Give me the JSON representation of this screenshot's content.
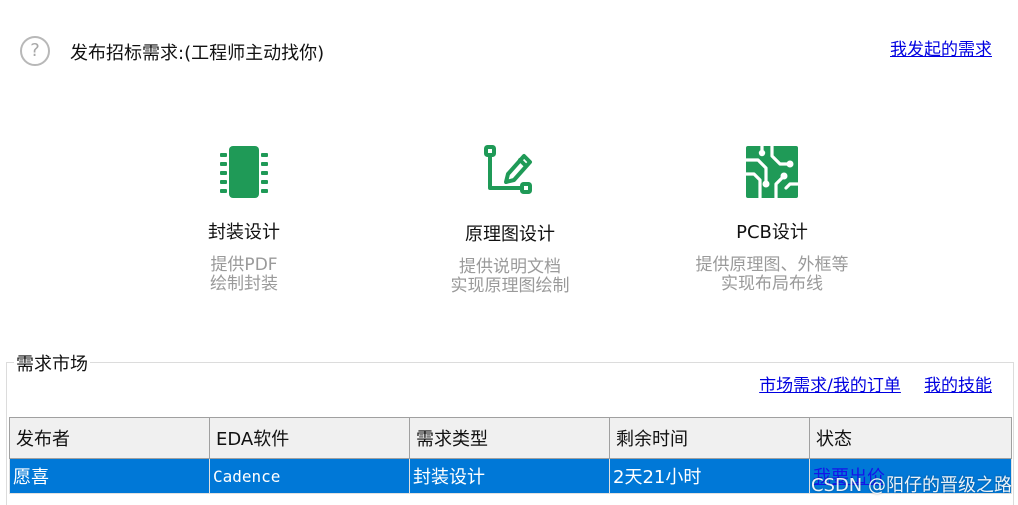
{
  "header": {
    "help_icon": "question-circle-icon",
    "title": "发布招标需求:(工程师主动找你)",
    "my_requests_link": "我发起的需求"
  },
  "services": [
    {
      "icon": "chip-icon",
      "name": "封装设计",
      "desc_line1": "提供PDF",
      "desc_line2": "绘制封装"
    },
    {
      "icon": "schematic-pen-icon",
      "name": "原理图设计",
      "desc_line1": "提供说明文档",
      "desc_line2": "实现原理图绘制"
    },
    {
      "icon": "pcb-circuit-icon",
      "name": "PCB设计",
      "desc_line1": "提供原理图、外框等",
      "desc_line2": "实现布局布线"
    }
  ],
  "market": {
    "title": "需求市场",
    "links": [
      "市场需求/我的订单",
      "我的技能"
    ],
    "columns": [
      "发布者",
      "EDA软件",
      "需求类型",
      "剩余时间",
      "状态"
    ],
    "rows": [
      {
        "publisher": "愿喜",
        "eda": "Cadence",
        "type": "封装设计",
        "remaining": "2天21小时",
        "status": "我要出价"
      }
    ]
  },
  "colors": {
    "accent_green": "#1f9a57",
    "selection_blue": "#0078d7",
    "link_blue": "#0000e0"
  },
  "watermark": "CSDN @阳仔的晋级之路"
}
